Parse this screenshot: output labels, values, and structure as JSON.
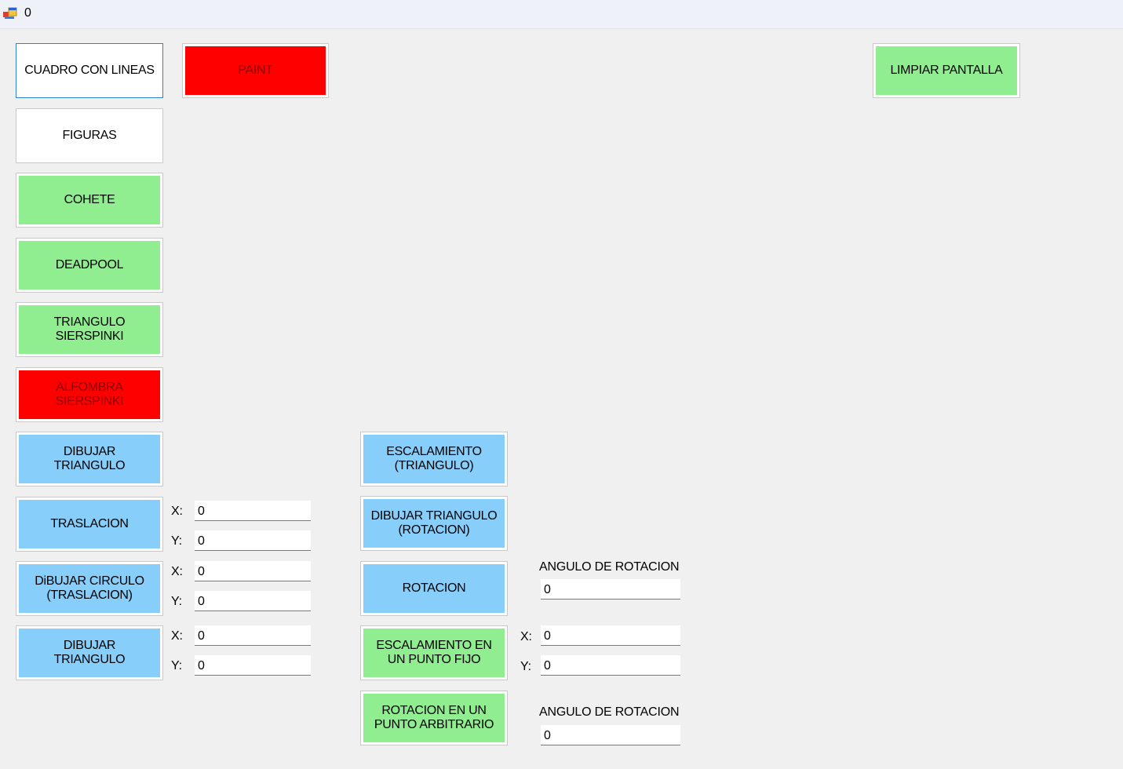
{
  "window": {
    "title": "0",
    "icon": "windows-form-icon"
  },
  "buttons": {
    "cuadro_lineas": "CUADRO CON LINEAS",
    "paint": "PAINT",
    "limpiar": "LIMPIAR PANTALLA",
    "figuras": "FIGURAS",
    "cohete": "COHETE",
    "deadpool": "DEADPOOL",
    "triangulo_sierspinki": "TRIANGULO\nSIERSPINKI",
    "alfombra_sierspinki": "ALFOMBRA\nSIERSPINKI",
    "dibujar_triangulo_1": "DIBUJAR\nTRIANGULO",
    "traslacion": "TRASLACION",
    "dibujar_circulo_traslacion": "DiBUJAR CIRCULO\n(TRASLACION)",
    "dibujar_triangulo_2": "DIBUJAR\nTRIANGULO",
    "escalamiento_triangulo": "ESCALAMIENTO\n(TRIANGULO)",
    "dibujar_triangulo_rotacion": "DIBUJAR TRIANGULO\n(ROTACION)",
    "rotacion": "ROTACION",
    "escalamiento_punto_fijo": "ESCALAMIENTO EN\nUN PUNTO FIJO",
    "rotacion_punto_arbitrario": "ROTACION EN UN\nPUNTO ARBITRARIO"
  },
  "labels": {
    "x": "X:",
    "y": "Y:",
    "angulo_rotacion": "ANGULO DE ROTACION"
  },
  "inputs": {
    "traslacion_x": "0",
    "traslacion_y": "0",
    "circulo_x": "0",
    "circulo_y": "0",
    "triangulo_x": "0",
    "triangulo_y": "0",
    "rotacion_angulo": "0",
    "punto_fijo_x": "0",
    "punto_fijo_y": "0",
    "arbitrario_angulo": "0"
  },
  "colors": {
    "green": "#90ee90",
    "blue": "#87cefa",
    "red": "#ff0000",
    "white": "#ffffff",
    "background": "#f0f0f0"
  }
}
